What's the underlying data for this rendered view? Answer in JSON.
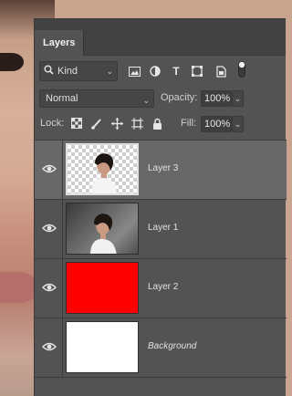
{
  "panel": {
    "tab_label": "Layers"
  },
  "filter": {
    "kind_label": "Kind",
    "icons": [
      "search-icon",
      "image-filter-icon",
      "adjustment-filter-icon",
      "type-filter-icon",
      "shape-filter-icon",
      "smart-object-filter-icon",
      "filter-toggle-icon"
    ]
  },
  "blend": {
    "mode": "Normal",
    "opacity_label": "Opacity:",
    "opacity_value": "100%"
  },
  "lock": {
    "label": "Lock:",
    "icons": [
      "lock-transparent-pixels-icon",
      "lock-image-pixels-icon",
      "lock-position-icon",
      "lock-artboard-icon",
      "lock-all-icon"
    ],
    "fill_label": "Fill:",
    "fill_value": "100%"
  },
  "layers": [
    {
      "name": "Layer 3",
      "selected": true,
      "thumb": "transparent-portrait"
    },
    {
      "name": "Layer 1",
      "selected": false,
      "thumb": "portrait"
    },
    {
      "name": "Layer 2",
      "selected": false,
      "thumb": "solid-red",
      "color": "#ff0000"
    },
    {
      "name": "Background",
      "selected": false,
      "thumb": "solid-white",
      "color": "#ffffff",
      "italic": true
    }
  ]
}
